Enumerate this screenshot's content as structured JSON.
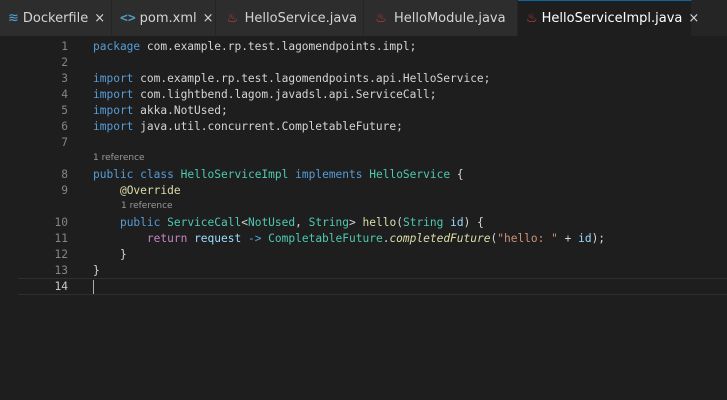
{
  "tabs": [
    {
      "label": "Dockerfile",
      "icon": "docker-icon",
      "close": "×",
      "active": false
    },
    {
      "label": "pom.xml",
      "icon": "xml-icon",
      "close": "×",
      "active": false
    },
    {
      "label": "HelloService.java",
      "icon": "java-icon",
      "close": "×",
      "active": false
    },
    {
      "label": "HelloModule.java",
      "icon": "java-icon",
      "close": "×",
      "active": false
    },
    {
      "label": "HelloServiceImpl.java",
      "icon": "java-icon",
      "close": "×",
      "active": true
    }
  ],
  "icons": {
    "docker": "≋",
    "xml": "<>",
    "java": "♨"
  },
  "line_numbers": [
    "1",
    "2",
    "3",
    "4",
    "5",
    "6",
    "7",
    "8",
    "9",
    "10",
    "11",
    "12",
    "13",
    "14"
  ],
  "codelens": {
    "class_refs": "1 reference",
    "method_refs": "1 reference"
  },
  "code": {
    "l1": {
      "kw": "package",
      "pkg": " com.example.rp.test.lagomendpoints.impl;"
    },
    "l3": {
      "kw": "import",
      "pkg": " com.example.rp.test.lagomendpoints.api.HelloService;"
    },
    "l4": {
      "kw": "import",
      "pkg": " com.lightbend.lagom.javadsl.api.ServiceCall;"
    },
    "l5": {
      "kw": "import",
      "pkg": " akka.NotUsed;"
    },
    "l6": {
      "kw": "import",
      "pkg": " java.util.concurrent.CompletableFuture;"
    },
    "l8": {
      "public": "public",
      "class": "class",
      "name": "HelloServiceImpl",
      "implements": "implements",
      "iface": "HelloService",
      "brace": " {"
    },
    "l9": {
      "annotation": "@Override"
    },
    "l10": {
      "public": "public",
      "ret_type": "ServiceCall",
      "lt": "<",
      "t1": "NotUsed",
      "comma": ", ",
      "t2": "String",
      "gt": ">",
      "method": "hello",
      "lp": "(",
      "ptype": "String",
      "pname": "id",
      "rp": ") {"
    },
    "l11": {
      "ret": "return",
      "var": "request",
      "arrow": " -> ",
      "cls": "CompletableFuture",
      "dot": ".",
      "call": "completedFuture",
      "lp": "(",
      "str": "\"hello: \"",
      "plus": " + ",
      "arg": "id",
      "end": ");"
    },
    "l12": {
      "brace": "}"
    },
    "l13": {
      "brace": "}"
    }
  },
  "colors": {
    "keyword": "#569cd6",
    "type": "#4ec9b0",
    "function": "#dcdcaa",
    "variable": "#9cdcfe",
    "string": "#ce9178",
    "return": "#c586c0"
  }
}
